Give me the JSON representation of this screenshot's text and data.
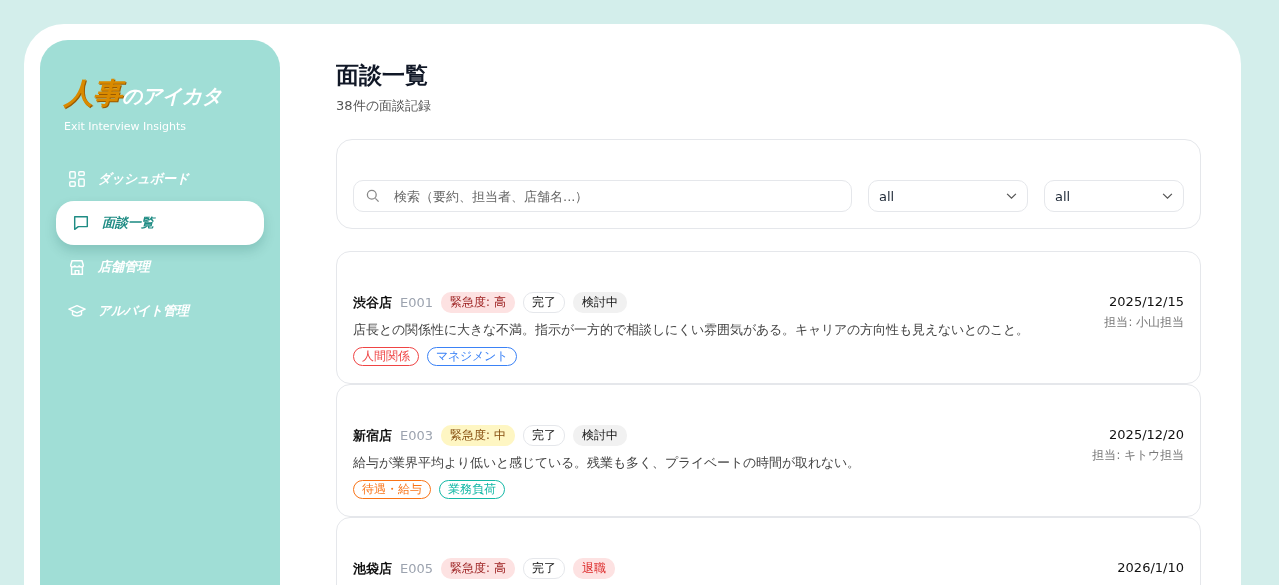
{
  "sidebar": {
    "logo": {
      "accent": "人事",
      "rest": "のアイカタ"
    },
    "tagline": "Exit Interview Insights",
    "items": [
      {
        "label": "ダッシュボード",
        "kind": "grid",
        "selected": false
      },
      {
        "label": "面談一覧",
        "kind": "chat",
        "selected": true
      },
      {
        "label": "店舗管理",
        "kind": "store",
        "selected": false
      },
      {
        "label": "アルバイト管理",
        "kind": "cap",
        "selected": false
      }
    ]
  },
  "header": {
    "title": "面談一覧",
    "subtitle": "38件の面談記録"
  },
  "filters": {
    "search": {
      "placeholder": "検索（要約、担当者、店舗名...）"
    },
    "selects": [
      {
        "value": "all"
      },
      {
        "value": "all"
      }
    ]
  },
  "interviews": [
    {
      "store": "渋谷店",
      "code": "E001",
      "badges": [
        {
          "label": "緊急度: 高",
          "kind": "high"
        },
        {
          "label": "完了",
          "kind": "outline"
        },
        {
          "label": "検討中",
          "kind": "gray"
        }
      ],
      "summary": "店長との関係性に大きな不満。指示が一方的で相談しにくい雰囲気がある。キャリアの方向性も見えないとのこと。",
      "tags": [
        {
          "label": "人間関係",
          "color": "#ef4444"
        },
        {
          "label": "マネジメント",
          "color": "#3b82f6"
        }
      ],
      "date": "2025/12/15",
      "manager": "担当: 小山担当"
    },
    {
      "store": "新宿店",
      "code": "E003",
      "badges": [
        {
          "label": "緊急度: 中",
          "kind": "medium"
        },
        {
          "label": "完了",
          "kind": "outline"
        },
        {
          "label": "検討中",
          "kind": "gray"
        }
      ],
      "summary": "給与が業界平均より低いと感じている。残業も多く、プライベートの時間が取れない。",
      "tags": [
        {
          "label": "待遇・給与",
          "color": "#f97316"
        },
        {
          "label": "業務負荷",
          "color": "#14b8a6"
        }
      ],
      "date": "2025/12/20",
      "manager": "担当: キトウ担当"
    },
    {
      "store": "池袋店",
      "code": "E005",
      "badges": [
        {
          "label": "緊急度: 高",
          "kind": "high"
        },
        {
          "label": "完了",
          "kind": "outline"
        },
        {
          "label": "退職",
          "kind": "danger"
        }
      ],
      "date": "2026/1/10"
    }
  ]
}
